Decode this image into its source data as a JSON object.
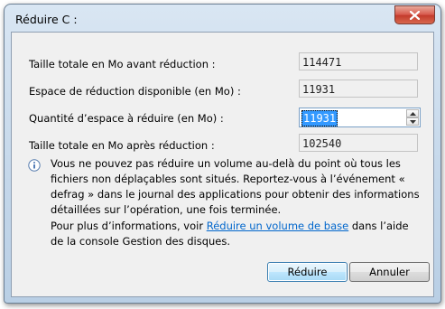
{
  "window": {
    "title": "Réduire C :"
  },
  "rows": [
    {
      "label": "Taille totale en Mo avant réduction :",
      "value": "114471"
    },
    {
      "label": "Espace de réduction disponible (en Mo) :",
      "value": "11931"
    },
    {
      "label": "Quantité d’espace à réduire (en Mo) :",
      "value": "11931"
    },
    {
      "label": "Taille totale en Mo après réduction :",
      "value": "102540"
    }
  ],
  "info": {
    "text": "Vous ne pouvez pas réduire un volume au-delà du point où tous les fichiers non déplaçables sont situés. Reportez-vous à l’événement « defrag » dans le journal des applications pour obtenir des informations détaillées sur l’opération, une fois terminée.",
    "more_prefix": "Pour plus d’informations, voir ",
    "more_link": "Réduire un volume de base",
    "more_suffix": " dans l’aide de la console Gestion des disques."
  },
  "buttons": {
    "shrink": "Réduire",
    "cancel": "Annuler"
  },
  "icons": {
    "close": "close-icon",
    "info": "info-icon",
    "spin_up": "spin-up-icon",
    "spin_down": "spin-down-icon"
  }
}
